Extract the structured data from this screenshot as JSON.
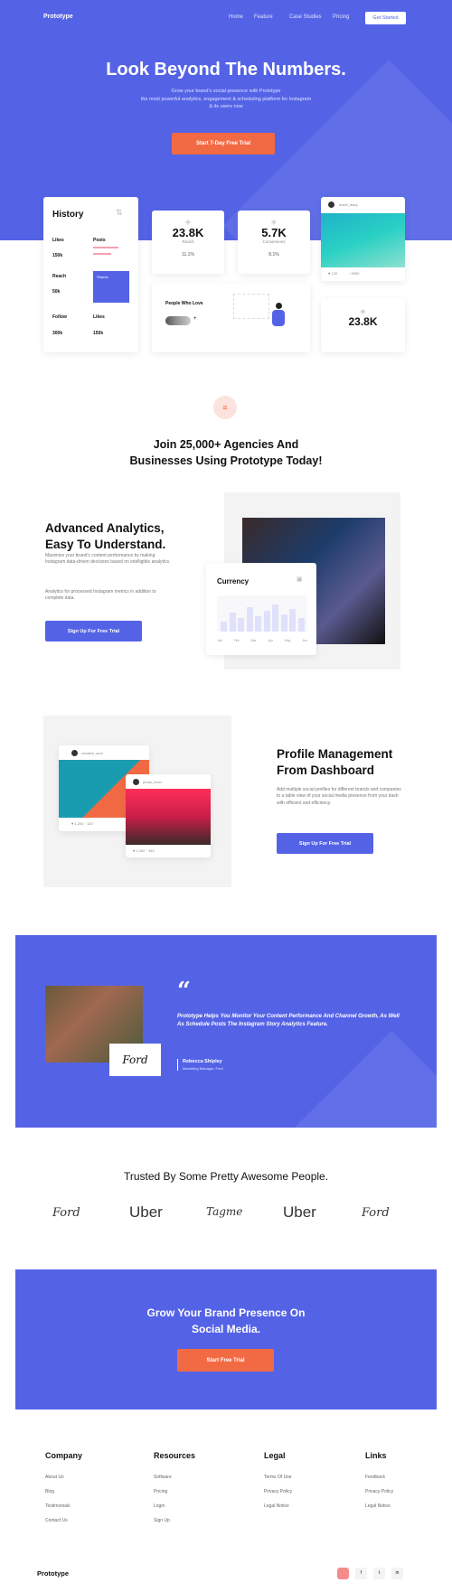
{
  "nav": {
    "logo": "Prototype",
    "links": [
      "Home",
      "Feature",
      "Case Studies",
      "Pricing"
    ],
    "cta": "Get Started"
  },
  "hero": {
    "title": "Look Beyond The Numbers.",
    "subtitle": [
      "Grow your brand’s social presence with Prototype",
      "the most powerful analytics, engagement & scheduling platform for Instagram",
      "& its users now"
    ],
    "button": "Start 7-Day Free Trial"
  },
  "dashboard": {
    "history": {
      "title": "History",
      "items": [
        {
          "label": "Likes",
          "value": "150k"
        },
        {
          "label": "Posts",
          "value": ""
        },
        {
          "label": "Reach",
          "value": "50k"
        },
        {
          "label": "Shares",
          "value": ""
        },
        {
          "label": "Follow",
          "value": "300k"
        },
        {
          "label": "Likes",
          "value": "150k"
        }
      ]
    },
    "stats": [
      {
        "value": "23.8K",
        "label": "Reach",
        "change": "11.1%"
      },
      {
        "value": "5.7K",
        "label": "Conversions",
        "change": "8.1%"
      }
    ],
    "post": {
      "user": "travel_diary",
      "likes": "120",
      "comments": "5000"
    },
    "people": {
      "title": "People Who Love",
      "more": "+"
    },
    "small_stat": {
      "value": "23.8K"
    }
  },
  "join": {
    "title_lines": [
      "Join 25,000+ Agencies And",
      "Businesses Using Prototype Today!"
    ]
  },
  "analytics": {
    "title_lines": [
      "Advanced Analytics,",
      "Easy To Understand."
    ],
    "para1": "Maximize your brand’s content performance by making Instagram data-driven decisions based on intelligible analytics.",
    "para2": "Analytics for processed Instagram metrics in addition to complete data.",
    "button": "Sign Up For Free Trial",
    "chart_title": "Currency",
    "chart_bars": [
      30,
      55,
      40,
      70,
      45,
      60,
      80,
      50,
      65,
      40
    ],
    "chart_labels": [
      "Jan",
      "Feb",
      "Mar",
      "Apr",
      "May",
      "Jun"
    ]
  },
  "profile": {
    "title_lines": [
      "Profile Management",
      "From Dashboard"
    ],
    "para": "Add multiple social profiles for different brands and companies to a table view of your social media presence from your dash with efficient and efficiency.",
    "button": "Sign Up For Free Trial",
    "posts": [
      {
        "user": "creative_soul",
        "likes": "1,200",
        "comments": "120"
      },
      {
        "user": "photo_lover",
        "likes": "2,300",
        "comments": "345"
      }
    ]
  },
  "testimonial": {
    "quote_mark": "“",
    "text": "Prototype Helps You Monitor Your Content Performance And Channel Growth, As Well As Schedule Posts The Instagram Story Analytics Feature.",
    "name": "Rebecca Shipley",
    "role": "Marketing Manager, Ford",
    "brand": "Ford"
  },
  "trusted": {
    "title": "Trusted By Some Pretty Awesome People.",
    "logos": [
      "Ford",
      "Uber",
      "Tagme",
      "Uber",
      "Ford"
    ]
  },
  "cta": {
    "title_lines": [
      "Grow Your Brand Presence On",
      "Social Media."
    ],
    "button": "Start Free Trial"
  },
  "footer": {
    "columns": [
      {
        "title": "Company",
        "links": [
          "About Us",
          "Blog",
          "Testimonials",
          "Contact Us"
        ]
      },
      {
        "title": "Resources",
        "links": [
          "Software",
          "Pricing",
          "Login",
          "Sign Up"
        ]
      },
      {
        "title": "Legal",
        "links": [
          "Terms Of Use",
          "Privacy Policy",
          "Legal Notice"
        ]
      },
      {
        "title": "Links",
        "links": [
          "Feedback",
          "Privacy Policy",
          "Legal Notice"
        ]
      }
    ],
    "brand": "Prototype",
    "social": [
      "instagram-icon",
      "facebook-icon",
      "twitter-icon",
      "linkedin-icon"
    ]
  },
  "colors": {
    "primary": "#5463e6",
    "accent": "#f26a43"
  }
}
